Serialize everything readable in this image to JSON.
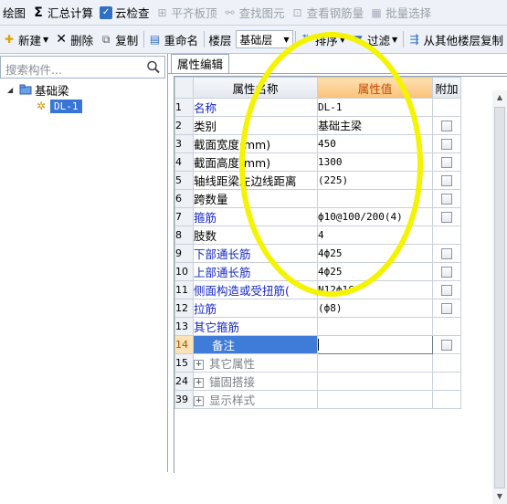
{
  "toolbar1": {
    "draw": "绘图",
    "sum_calc": "汇总计算",
    "cloud_check": "云检查",
    "align_slab": "平齐板顶",
    "find_element": "查找图元",
    "view_rebar": "查看钢筋量",
    "batch_select": "批量选择"
  },
  "toolbar2": {
    "new": "新建",
    "delete": "删除",
    "copy": "复制",
    "rename": "重命名",
    "floor_label": "楼层",
    "floor_value": "基础层",
    "sort": "排序",
    "filter": "过滤",
    "copy_from_floor": "从其他楼层复制"
  },
  "search": {
    "placeholder": "搜索构件..."
  },
  "tree": {
    "parent": "基础梁",
    "child": "DL-1"
  },
  "panel": {
    "tab": "属性编辑"
  },
  "grid": {
    "headers": {
      "name": "属性名称",
      "value": "属性值",
      "extra": "附加"
    },
    "rows": [
      {
        "idx": "1",
        "name": "名称",
        "value": "DL-1",
        "checkbox": false
      },
      {
        "idx": "2",
        "name": "类别",
        "value": "基础主梁",
        "checkbox": true
      },
      {
        "idx": "3",
        "name": "截面宽度(mm)",
        "value": "450",
        "checkbox": true
      },
      {
        "idx": "4",
        "name": "截面高度(mm)",
        "value": "1300",
        "checkbox": true
      },
      {
        "idx": "5",
        "name": "轴线距梁左边线距离",
        "value": "(225)",
        "checkbox": true
      },
      {
        "idx": "6",
        "name": "跨数量",
        "value": "",
        "checkbox": true
      },
      {
        "idx": "7",
        "name": "箍筋",
        "value": "ф10@100/200(4)",
        "checkbox": true
      },
      {
        "idx": "8",
        "name": "肢数",
        "value": "4",
        "checkbox": false
      },
      {
        "idx": "9",
        "name": "下部通长筋",
        "value": "4ф25",
        "checkbox": true
      },
      {
        "idx": "10",
        "name": "上部通长筋",
        "value": "4ф25",
        "checkbox": true
      },
      {
        "idx": "11",
        "name": "侧面构造或受扭筋(",
        "value": "N12ф16",
        "checkbox": true
      },
      {
        "idx": "12",
        "name": "拉筋",
        "value": "(ф8)",
        "checkbox": true
      },
      {
        "idx": "13",
        "name": "其它箍筋",
        "value": "",
        "checkbox": false
      },
      {
        "idx": "14",
        "name": "备注",
        "value": "",
        "checkbox": true
      },
      {
        "idx": "15",
        "name": "其它属性",
        "value": "",
        "checkbox": false
      },
      {
        "idx": "24",
        "name": "锚固搭接",
        "value": "",
        "checkbox": false
      },
      {
        "idx": "39",
        "name": "显示样式",
        "value": "",
        "checkbox": false
      }
    ]
  },
  "colors": {
    "highlight": "#f4f400",
    "selection": "#3f7bd9",
    "value_header": "#f8c27a"
  }
}
